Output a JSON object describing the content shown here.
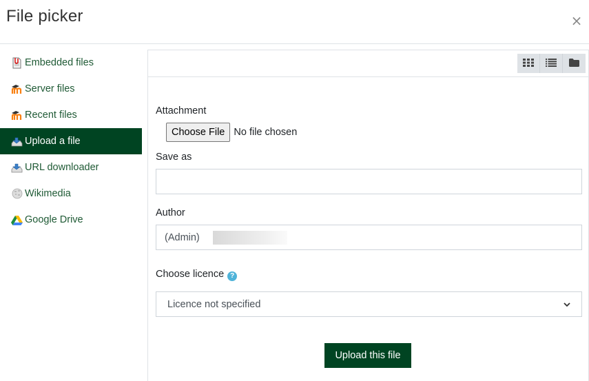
{
  "header": {
    "title": "File picker",
    "close_icon": "close-icon"
  },
  "sidebar": {
    "items": [
      {
        "label": "Embedded files",
        "icon": "embedded-files-icon",
        "active": false
      },
      {
        "label": "Server files",
        "icon": "moodle-icon",
        "active": false
      },
      {
        "label": "Recent files",
        "icon": "moodle-icon",
        "active": false
      },
      {
        "label": "Upload a file",
        "icon": "upload-icon",
        "active": true
      },
      {
        "label": "URL downloader",
        "icon": "upload-icon",
        "active": false
      },
      {
        "label": "Wikimedia",
        "icon": "wikipedia-icon",
        "active": false
      },
      {
        "label": "Google Drive",
        "icon": "google-drive-icon",
        "active": false
      }
    ]
  },
  "toolbar": {
    "views": [
      "grid-view-icon",
      "list-view-icon",
      "folder-view-icon"
    ]
  },
  "form": {
    "attachment_label": "Attachment",
    "choose_file_label": "Choose File",
    "no_file_text": "No file chosen",
    "save_as_label": "Save as",
    "save_as_value": "",
    "author_label": "Author",
    "author_value": "(Admin)",
    "licence_label": "Choose licence",
    "licence_selected": "Licence not specified",
    "upload_button_label": "Upload this file"
  },
  "colors": {
    "brand_green": "#004422",
    "help_blue": "#4fb3d9"
  }
}
